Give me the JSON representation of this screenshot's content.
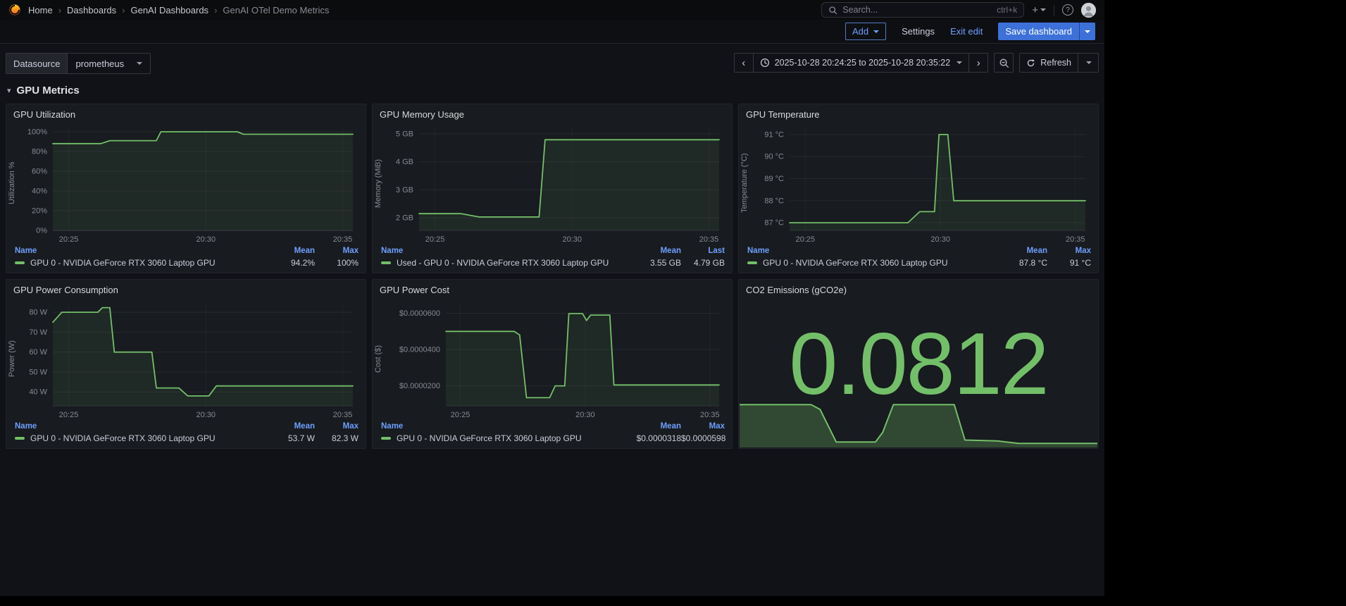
{
  "icons": {
    "chevron_right": "›",
    "chevron_left": "‹",
    "caret_down": "▾",
    "plus": "+",
    "help": "?"
  },
  "colors": {
    "green": "#73BF69",
    "primary_blue": "#3D71D9",
    "link_blue": "#6E9FFF",
    "panel_bg": "#181B1F",
    "page_bg": "#111217"
  },
  "nav": {
    "breadcrumb": [
      "Home",
      "Dashboards",
      "GenAI Dashboards",
      "GenAI OTel Demo Metrics"
    ],
    "search": {
      "placeholder": "Search...",
      "shortcut": "ctrl+k"
    }
  },
  "edit_bar": {
    "add_label": "Add",
    "settings_label": "Settings",
    "exit_edit_label": "Exit edit",
    "save_label": "Save dashboard"
  },
  "controls": {
    "datasource_label": "Datasource",
    "datasource_value": "prometheus",
    "time_range": "2025-10-28 20:24:25 to 2025-10-28 20:35:22",
    "refresh_label": "Refresh"
  },
  "row_header": {
    "title": "GPU Metrics"
  },
  "panels": [
    {
      "title": "GPU Utilization",
      "y_label": "Utilization %",
      "legend": {
        "columns": [
          "Name",
          "Mean",
          "Max"
        ]
      },
      "series_name": "GPU 0 - NVIDIA GeForce RTX 3060 Laptop GPU",
      "stats": [
        "94.2%",
        "100%"
      ],
      "chart": {
        "kind": "timeseries",
        "color": "#73BF69",
        "ylim": [
          0,
          105
        ],
        "yticks": [
          {
            "value": 0,
            "label": "0%"
          },
          {
            "value": 20,
            "label": "20%"
          },
          {
            "value": 40,
            "label": "40%"
          },
          {
            "value": 60,
            "label": "60%"
          },
          {
            "value": 80,
            "label": "80%"
          },
          {
            "value": 100,
            "label": "100%"
          }
        ],
        "xticks": [
          {
            "frac": 0.053,
            "label": "20:25"
          },
          {
            "frac": 0.51,
            "label": "20:30"
          },
          {
            "frac": 0.966,
            "label": "20:35"
          }
        ],
        "points": [
          [
            0,
            88
          ],
          [
            0.16,
            88
          ],
          [
            0.19,
            91
          ],
          [
            0.345,
            91
          ],
          [
            0.36,
            100
          ],
          [
            0.615,
            100
          ],
          [
            0.635,
            97.5
          ],
          [
            1,
            97.5
          ]
        ]
      }
    },
    {
      "title": "GPU Memory Usage",
      "y_label": "Memory (MiB)",
      "legend": {
        "columns": [
          "Name",
          "Mean",
          "Last"
        ]
      },
      "series_name": "Used - GPU 0 - NVIDIA GeForce RTX 3060 Laptop GPU",
      "stats": [
        "3.55 GB",
        "4.79 GB"
      ],
      "chart": {
        "kind": "timeseries",
        "color": "#73BF69",
        "ylim": [
          1.55,
          5.25
        ],
        "yticks": [
          {
            "value": 2,
            "label": "2 GB"
          },
          {
            "value": 3,
            "label": "3 GB"
          },
          {
            "value": 4,
            "label": "4 GB"
          },
          {
            "value": 5,
            "label": "5 GB"
          }
        ],
        "xticks": [
          {
            "frac": 0.053,
            "label": "20:25"
          },
          {
            "frac": 0.51,
            "label": "20:30"
          },
          {
            "frac": 0.966,
            "label": "20:35"
          }
        ],
        "points": [
          [
            0,
            2.15
          ],
          [
            0.14,
            2.15
          ],
          [
            0.2,
            2.03
          ],
          [
            0.4,
            2.03
          ],
          [
            0.42,
            4.79
          ],
          [
            1,
            4.79
          ]
        ]
      }
    },
    {
      "title": "GPU Temperature",
      "y_label": "Temperature (°C)",
      "legend": {
        "columns": [
          "Name",
          "Mean",
          "Max"
        ]
      },
      "series_name": "GPU 0 - NVIDIA GeForce RTX 3060 Laptop GPU",
      "stats": [
        "87.8 °C",
        "91 °C"
      ],
      "chart": {
        "kind": "timeseries",
        "color": "#73BF69",
        "ylim": [
          86.65,
          91.35
        ],
        "yticks": [
          {
            "value": 87,
            "label": "87 °C"
          },
          {
            "value": 88,
            "label": "88 °C"
          },
          {
            "value": 89,
            "label": "89 °C"
          },
          {
            "value": 90,
            "label": "90 °C"
          },
          {
            "value": 91,
            "label": "91 °C"
          }
        ],
        "xticks": [
          {
            "frac": 0.053,
            "label": "20:25"
          },
          {
            "frac": 0.51,
            "label": "20:30"
          },
          {
            "frac": 0.966,
            "label": "20:35"
          }
        ],
        "points": [
          [
            0,
            87
          ],
          [
            0.4,
            87
          ],
          [
            0.44,
            87.5
          ],
          [
            0.49,
            87.5
          ],
          [
            0.505,
            91
          ],
          [
            0.535,
            91
          ],
          [
            0.555,
            88
          ],
          [
            1,
            88
          ]
        ]
      }
    },
    {
      "title": "GPU Power Consumption",
      "y_label": "Power (W)",
      "legend": {
        "columns": [
          "Name",
          "Mean",
          "Max"
        ]
      },
      "series_name": "GPU 0 - NVIDIA GeForce RTX 3060 Laptop GPU",
      "stats": [
        "53.7 W",
        "82.3 W"
      ],
      "chart": {
        "kind": "timeseries",
        "color": "#73BF69",
        "ylim": [
          33,
          85
        ],
        "yticks": [
          {
            "value": 40,
            "label": "40 W"
          },
          {
            "value": 50,
            "label": "50 W"
          },
          {
            "value": 60,
            "label": "60 W"
          },
          {
            "value": 70,
            "label": "70 W"
          },
          {
            "value": 80,
            "label": "80 W"
          }
        ],
        "xticks": [
          {
            "frac": 0.053,
            "label": "20:25"
          },
          {
            "frac": 0.51,
            "label": "20:30"
          },
          {
            "frac": 0.966,
            "label": "20:35"
          }
        ],
        "points": [
          [
            0,
            75
          ],
          [
            0.03,
            80
          ],
          [
            0.15,
            80
          ],
          [
            0.165,
            82.3
          ],
          [
            0.19,
            82.3
          ],
          [
            0.205,
            60
          ],
          [
            0.33,
            60
          ],
          [
            0.345,
            42
          ],
          [
            0.42,
            42
          ],
          [
            0.45,
            38
          ],
          [
            0.52,
            38
          ],
          [
            0.545,
            43
          ],
          [
            1,
            43
          ]
        ]
      }
    },
    {
      "title": "GPU Power Cost",
      "y_label": "Cost ($)",
      "legend": {
        "columns": [
          "Name",
          "Mean",
          "Max"
        ]
      },
      "series_name": "GPU 0 - NVIDIA GeForce RTX 3060 Laptop GPU",
      "stats": [
        "$0.0000318",
        "$0.0000598"
      ],
      "chart": {
        "kind": "timeseries",
        "color": "#73BF69",
        "ylim": [
          9e-06,
          6.6e-05
        ],
        "yticks": [
          {
            "value": 2e-05,
            "label": "$0.0000200"
          },
          {
            "value": 4e-05,
            "label": "$0.0000400"
          },
          {
            "value": 6e-05,
            "label": "$0.0000600"
          }
        ],
        "xticks": [
          {
            "frac": 0.053,
            "label": "20:25"
          },
          {
            "frac": 0.51,
            "label": "20:30"
          },
          {
            "frac": 0.966,
            "label": "20:35"
          }
        ],
        "points": [
          [
            0,
            5e-05
          ],
          [
            0.25,
            5e-05
          ],
          [
            0.27,
            4.8e-05
          ],
          [
            0.295,
            1.35e-05
          ],
          [
            0.38,
            1.35e-05
          ],
          [
            0.4,
            2e-05
          ],
          [
            0.435,
            2e-05
          ],
          [
            0.45,
            5.98e-05
          ],
          [
            0.5,
            5.98e-05
          ],
          [
            0.515,
            5.6e-05
          ],
          [
            0.53,
            5.9e-05
          ],
          [
            0.6,
            5.9e-05
          ],
          [
            0.615,
            2.05e-05
          ],
          [
            1,
            2.05e-05
          ]
        ]
      }
    },
    {
      "title": "CO2 Emissions (gCO2e)",
      "stat_value": "0.0812",
      "chart": {
        "kind": "sparkline",
        "color": "#73BF69",
        "ylim": [
          0,
          1
        ],
        "points": [
          [
            0,
            0.88
          ],
          [
            0.2,
            0.88
          ],
          [
            0.225,
            0.78
          ],
          [
            0.27,
            0.1
          ],
          [
            0.38,
            0.1
          ],
          [
            0.4,
            0.3
          ],
          [
            0.43,
            0.88
          ],
          [
            0.6,
            0.88
          ],
          [
            0.63,
            0.14
          ],
          [
            0.72,
            0.12
          ],
          [
            0.78,
            0.07
          ],
          [
            1,
            0.07
          ]
        ]
      }
    }
  ]
}
